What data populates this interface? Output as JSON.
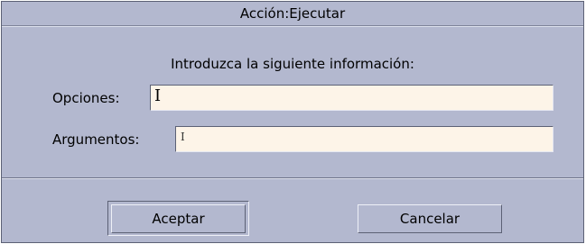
{
  "dialog": {
    "title": "Acción:Ejecutar",
    "prompt": "Introduzca la siguiente información:",
    "fields": [
      {
        "label": "Opciones:",
        "value": ""
      },
      {
        "label": "Argumentos:",
        "value": ""
      }
    ],
    "buttons": {
      "ok_label": "Aceptar",
      "cancel_label": "Cancelar"
    }
  }
}
